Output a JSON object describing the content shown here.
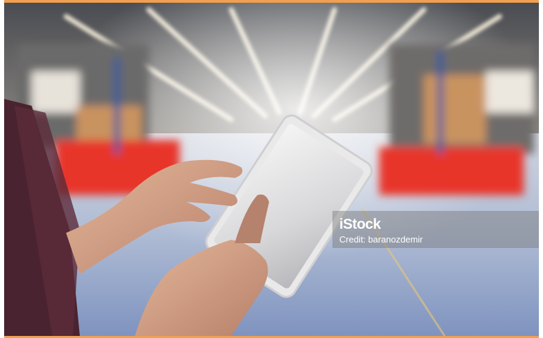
{
  "watermark": {
    "brand": "iStock",
    "credit": "Credit: baranozdemir"
  },
  "colors": {
    "accent": "#f0a050",
    "floor": "#b9c6dc",
    "shelving_red": "#e8342a",
    "boxes": "#c9935e"
  },
  "scene": {
    "description_icon": "warehouse-photo"
  }
}
